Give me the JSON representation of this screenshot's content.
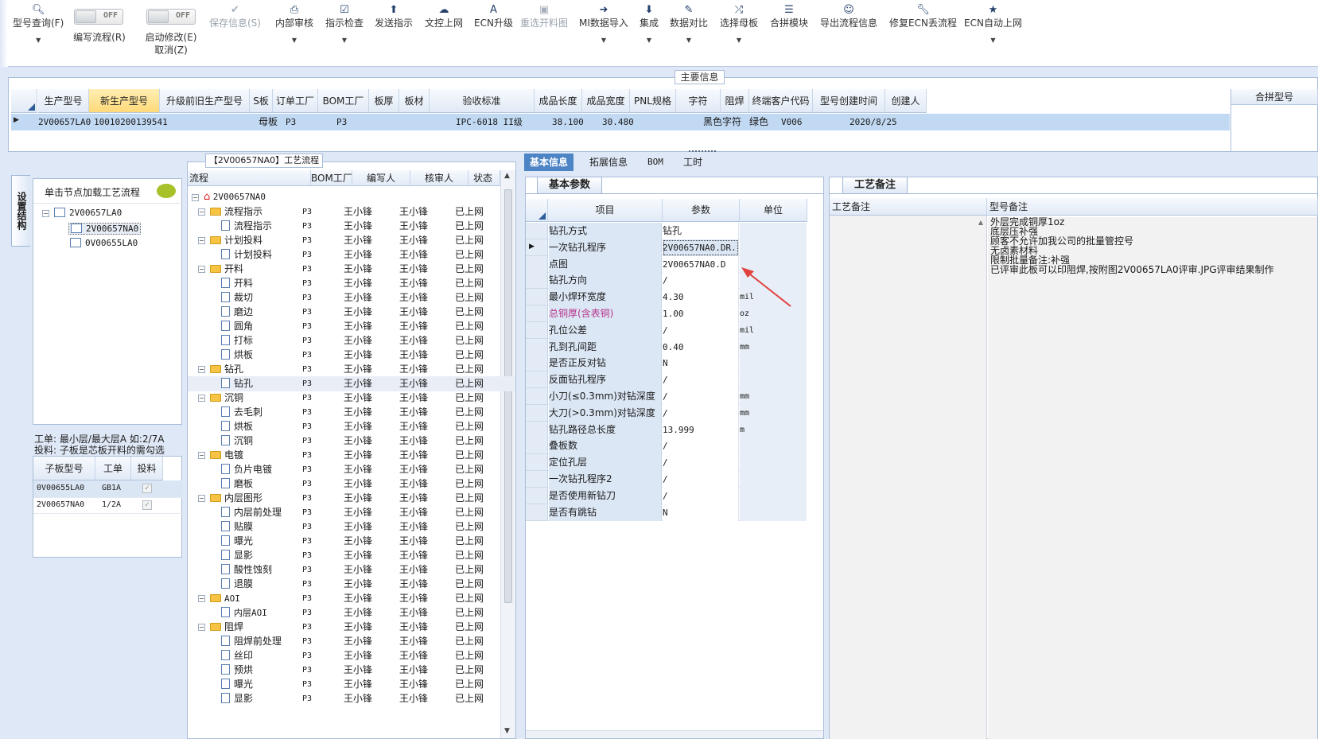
{
  "toolbar": {
    "query_label": "型号查询(F)",
    "edit_flow_label": "编写流程(R)",
    "start_modify_line1": "启动修改(E)",
    "start_modify_line2": "取消(Z)",
    "toggle_off": "OFF",
    "save_label": "保存信息(S)",
    "internal_review": "内部审核",
    "instruction_check": "指示检查",
    "send_instruction": "发送指示",
    "doc_upload": "文控上网",
    "ecn_upgrade": "ECN升级",
    "reselect_image": "重选开料图",
    "mi_import": "MI数据导入",
    "integrate": "集成",
    "data_compare": "数据对比",
    "select_master": "选择母板",
    "merge_module": "合拼模块",
    "export_flow": "导出流程信息",
    "repair_ecn": "修复ECN丢流程",
    "ecn_auto_upload": "ECN自动上网"
  },
  "main_info": {
    "title": "主要信息",
    "columns": [
      "生产型号",
      "新生产型号",
      "升级前旧生产型号",
      "S板",
      "订单工厂",
      "BOM工厂",
      "板厚",
      "板材",
      "验收标准",
      "成品长度",
      "成品宽度",
      "PNL规格",
      "字符",
      "阻焊",
      "终端客户代码",
      "型号创建时间",
      "创建人"
    ],
    "row": {
      "prod_model": "2V00657LA0",
      "new_model": "10010200139541",
      "s_board": "母板",
      "order_factory": "P3",
      "bom_factory": "P3",
      "standard": "IPC-6018 II级",
      "length": "38.100",
      "width": "30.480",
      "char": "黑色字符",
      "solder": "绿色",
      "customer": "V006",
      "created": "2020/8/25"
    },
    "merge_header": "合拼型号"
  },
  "left": {
    "vtab": "设置结构",
    "hint": "单击节点加载工艺流程",
    "tree": [
      "2V00657LA0",
      "2V00657NA0",
      "0V00655LA0"
    ],
    "note1": "工单: 最小层/最大层A 如:2/7A",
    "note2": "投料: 子板是芯板开料的需勾选",
    "headers": [
      "子板型号",
      "工单",
      "投料"
    ],
    "rows": [
      {
        "model": "0V00655LA0",
        "order": "GB1A"
      },
      {
        "model": "2V00657NA0",
        "order": "1/2A"
      }
    ]
  },
  "flow": {
    "title": "【2V00657NA0】工艺流程",
    "headers": [
      "流程",
      "BOM工厂",
      "编写人",
      "核审人",
      "状态"
    ],
    "root": "2V00657NA0",
    "writer": "王小锋",
    "reviewer": "王小锋",
    "factory": "P3",
    "status": "已上网",
    "rows": [
      {
        "t": "f",
        "n": "流程指示"
      },
      {
        "t": "d",
        "n": "流程指示"
      },
      {
        "t": "f",
        "n": "计划投料"
      },
      {
        "t": "d",
        "n": "计划投料"
      },
      {
        "t": "f",
        "n": "开料"
      },
      {
        "t": "d",
        "n": "开料"
      },
      {
        "t": "d",
        "n": "裁切"
      },
      {
        "t": "d",
        "n": "磨边"
      },
      {
        "t": "d",
        "n": "圆角"
      },
      {
        "t": "d",
        "n": "打标"
      },
      {
        "t": "d",
        "n": "烘板"
      },
      {
        "t": "f",
        "n": "钻孔"
      },
      {
        "t": "d",
        "n": "钻孔"
      },
      {
        "t": "f",
        "n": "沉铜"
      },
      {
        "t": "d",
        "n": "去毛刺"
      },
      {
        "t": "d",
        "n": "烘板"
      },
      {
        "t": "d",
        "n": "沉铜"
      },
      {
        "t": "f",
        "n": "电镀"
      },
      {
        "t": "d",
        "n": "负片电镀"
      },
      {
        "t": "d",
        "n": "磨板"
      },
      {
        "t": "f",
        "n": "内层图形"
      },
      {
        "t": "d",
        "n": "内层前处理"
      },
      {
        "t": "d",
        "n": "贴膜"
      },
      {
        "t": "d",
        "n": "曝光"
      },
      {
        "t": "d",
        "n": "显影"
      },
      {
        "t": "d",
        "n": "酸性蚀刻"
      },
      {
        "t": "d",
        "n": "退膜"
      },
      {
        "t": "f",
        "n": "AOI"
      },
      {
        "t": "d",
        "n": "内层AOI"
      },
      {
        "t": "f",
        "n": "阻焊"
      },
      {
        "t": "d",
        "n": "阻焊前处理"
      },
      {
        "t": "d",
        "n": "丝印"
      },
      {
        "t": "d",
        "n": "预烘"
      },
      {
        "t": "d",
        "n": "曝光"
      },
      {
        "t": "d",
        "n": "显影"
      }
    ]
  },
  "params": {
    "tabs": [
      "基本信息",
      "拓展信息",
      "BOM",
      "工时"
    ],
    "subtab": "基本参数",
    "headers": [
      "项目",
      "参数",
      "单位"
    ],
    "rows": [
      {
        "k": "钻孔方式",
        "v": "钻孔",
        "u": ""
      },
      {
        "k": "一次钻孔程序",
        "v": "2V00657NA0.DR...",
        "u": ""
      },
      {
        "k": "点图",
        "v": "2V00657NA0.D",
        "u": ""
      },
      {
        "k": "钻孔方向",
        "v": "/",
        "u": ""
      },
      {
        "k": "最小焊环宽度",
        "v": "4.30",
        "u": "mil"
      },
      {
        "k": "总铜厚(含表铜)",
        "v": "1.00",
        "u": "oz"
      },
      {
        "k": "孔位公差",
        "v": "/",
        "u": "mil"
      },
      {
        "k": "孔到孔间距",
        "v": "0.40",
        "u": "mm"
      },
      {
        "k": "是否正反对钻",
        "v": "N",
        "u": ""
      },
      {
        "k": "反面钻孔程序",
        "v": "/",
        "u": ""
      },
      {
        "k": "小刀(≤0.3mm)对钻深度",
        "v": "/",
        "u": "mm"
      },
      {
        "k": "大刀(>0.3mm)对钻深度",
        "v": "/",
        "u": "mm"
      },
      {
        "k": "钻孔路径总长度",
        "v": "13.999",
        "u": "m"
      },
      {
        "k": "叠板数",
        "v": "/",
        "u": ""
      },
      {
        "k": "定位孔层",
        "v": "/",
        "u": ""
      },
      {
        "k": "一次钻孔程序2",
        "v": "/",
        "u": ""
      },
      {
        "k": "是否使用新钻刀",
        "v": "/",
        "u": ""
      },
      {
        "k": "是否有跳钻",
        "v": "N",
        "u": ""
      }
    ],
    "highlight_color": "#b5338a"
  },
  "notes": {
    "tab": "工艺备注",
    "headers": [
      "工艺备注",
      "型号备注"
    ],
    "lines": [
      "外层完成铜厚1oz",
      "底层压补强",
      "顾客不允许加我公司的批量管控号",
      "无卤素材料",
      "限制批量备注:补强",
      "已评审此板可以印阻焊,按附图2V00657LA0评审.JPG评审结果制作"
    ]
  }
}
